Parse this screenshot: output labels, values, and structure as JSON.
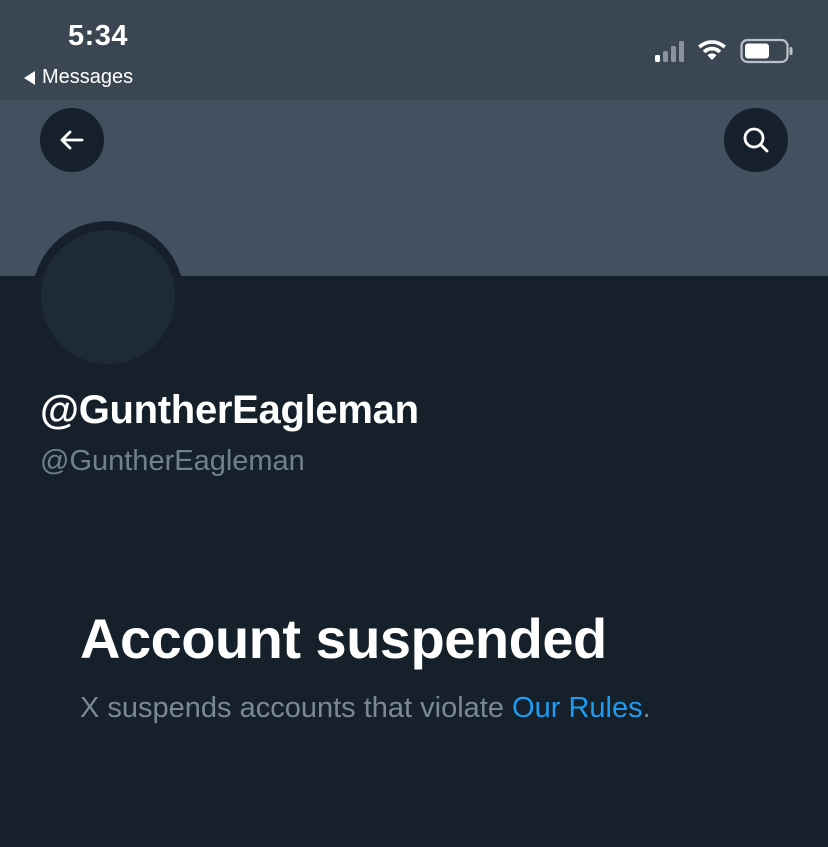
{
  "status_bar": {
    "time": "5:34",
    "back_label": "Messages",
    "signal_bars_active": 1,
    "battery_level": 0.6
  },
  "header": {
    "back_icon": "arrow-left-icon",
    "search_icon": "search-icon"
  },
  "profile": {
    "display_name": "@GuntherEagleman",
    "handle": "@GuntherEagleman"
  },
  "suspension": {
    "title": "Account suspended",
    "message_prefix": "X suspends accounts that violate ",
    "rules_link": "Our Rules",
    "message_suffix": "."
  },
  "colors": {
    "background": "#15202b",
    "banner": "#425060",
    "link": "#1d9bf0",
    "secondary_text": "#71808f"
  }
}
